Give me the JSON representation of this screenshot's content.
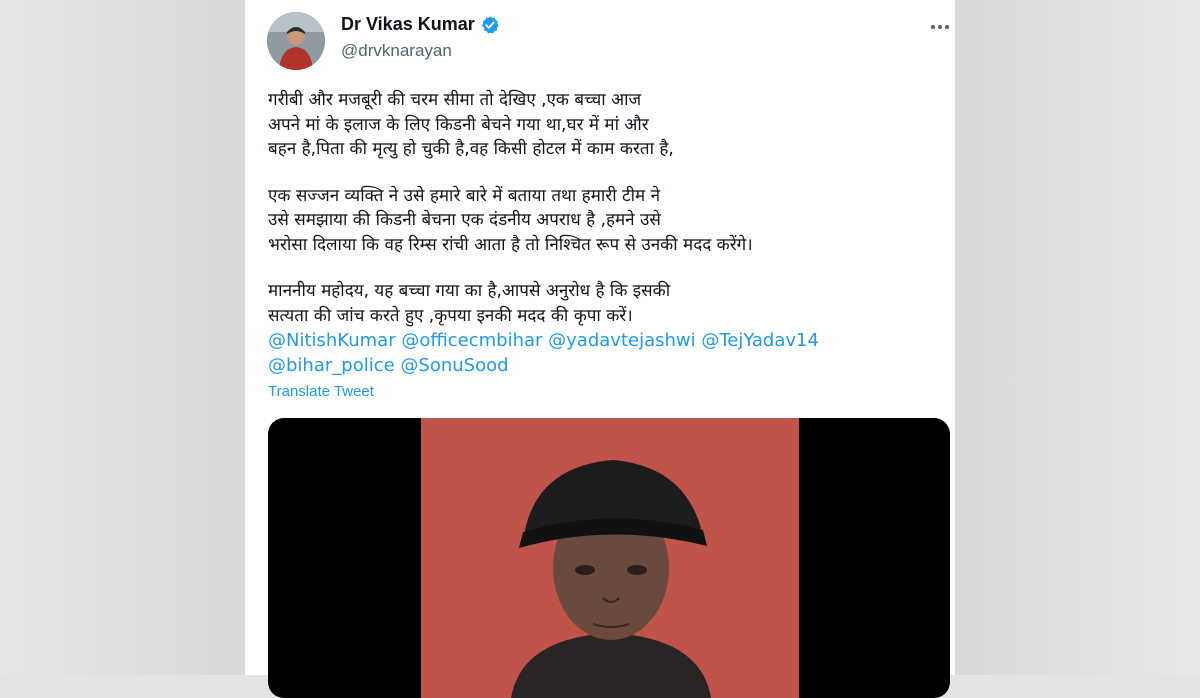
{
  "author": {
    "name": "Dr Vikas Kumar",
    "handle": "@drvknarayan",
    "verified": true,
    "verified_color": "#1d9bf0"
  },
  "tweet": {
    "paragraphs": [
      [
        "गरीबी और मजबूरी की चरम सीमा तो देखिए ,एक बच्चा आज",
        "अपने मां के इलाज के लिए किडनी बेचने गया था,घर में मां और",
        "बहन है,पिता की मृत्यु हो चुकी है,वह किसी होटल में काम करता है,"
      ],
      [
        "एक सज्जन व्यक्ति ने उसे हमारे बारे में बताया तथा हमारी टीम ने",
        "उसे समझाया की किडनी बेचना एक दंडनीय अपराध है ,हमने उसे",
        "भरोसा दिलाया कि वह रिम्स रांची आता है तो निश्चित रूप से उनकी मदद करेंगे।"
      ],
      [
        "माननीय महोदय, यह बच्चा गया का है,आपसे अनुरोध है कि इसकी",
        "सत्यता की जांच करते हुए ,कृपया इनकी मदद की कृपा करें।"
      ]
    ],
    "mentions_line1": [
      "@NitishKumar",
      "@officecmbihar",
      "@yadavtejashwi",
      "@TejYadav14"
    ],
    "mentions_line2": [
      "@bihar_police",
      "@SonuSood"
    ],
    "translate_label": "Translate Tweet"
  },
  "icons": {
    "more": "more-horizontal-icon",
    "verified": "verified-badge-icon"
  },
  "colors": {
    "link": "#1d9bf0",
    "text": "#0f1419",
    "secondary": "#536471",
    "video_background": "#c0544a"
  }
}
